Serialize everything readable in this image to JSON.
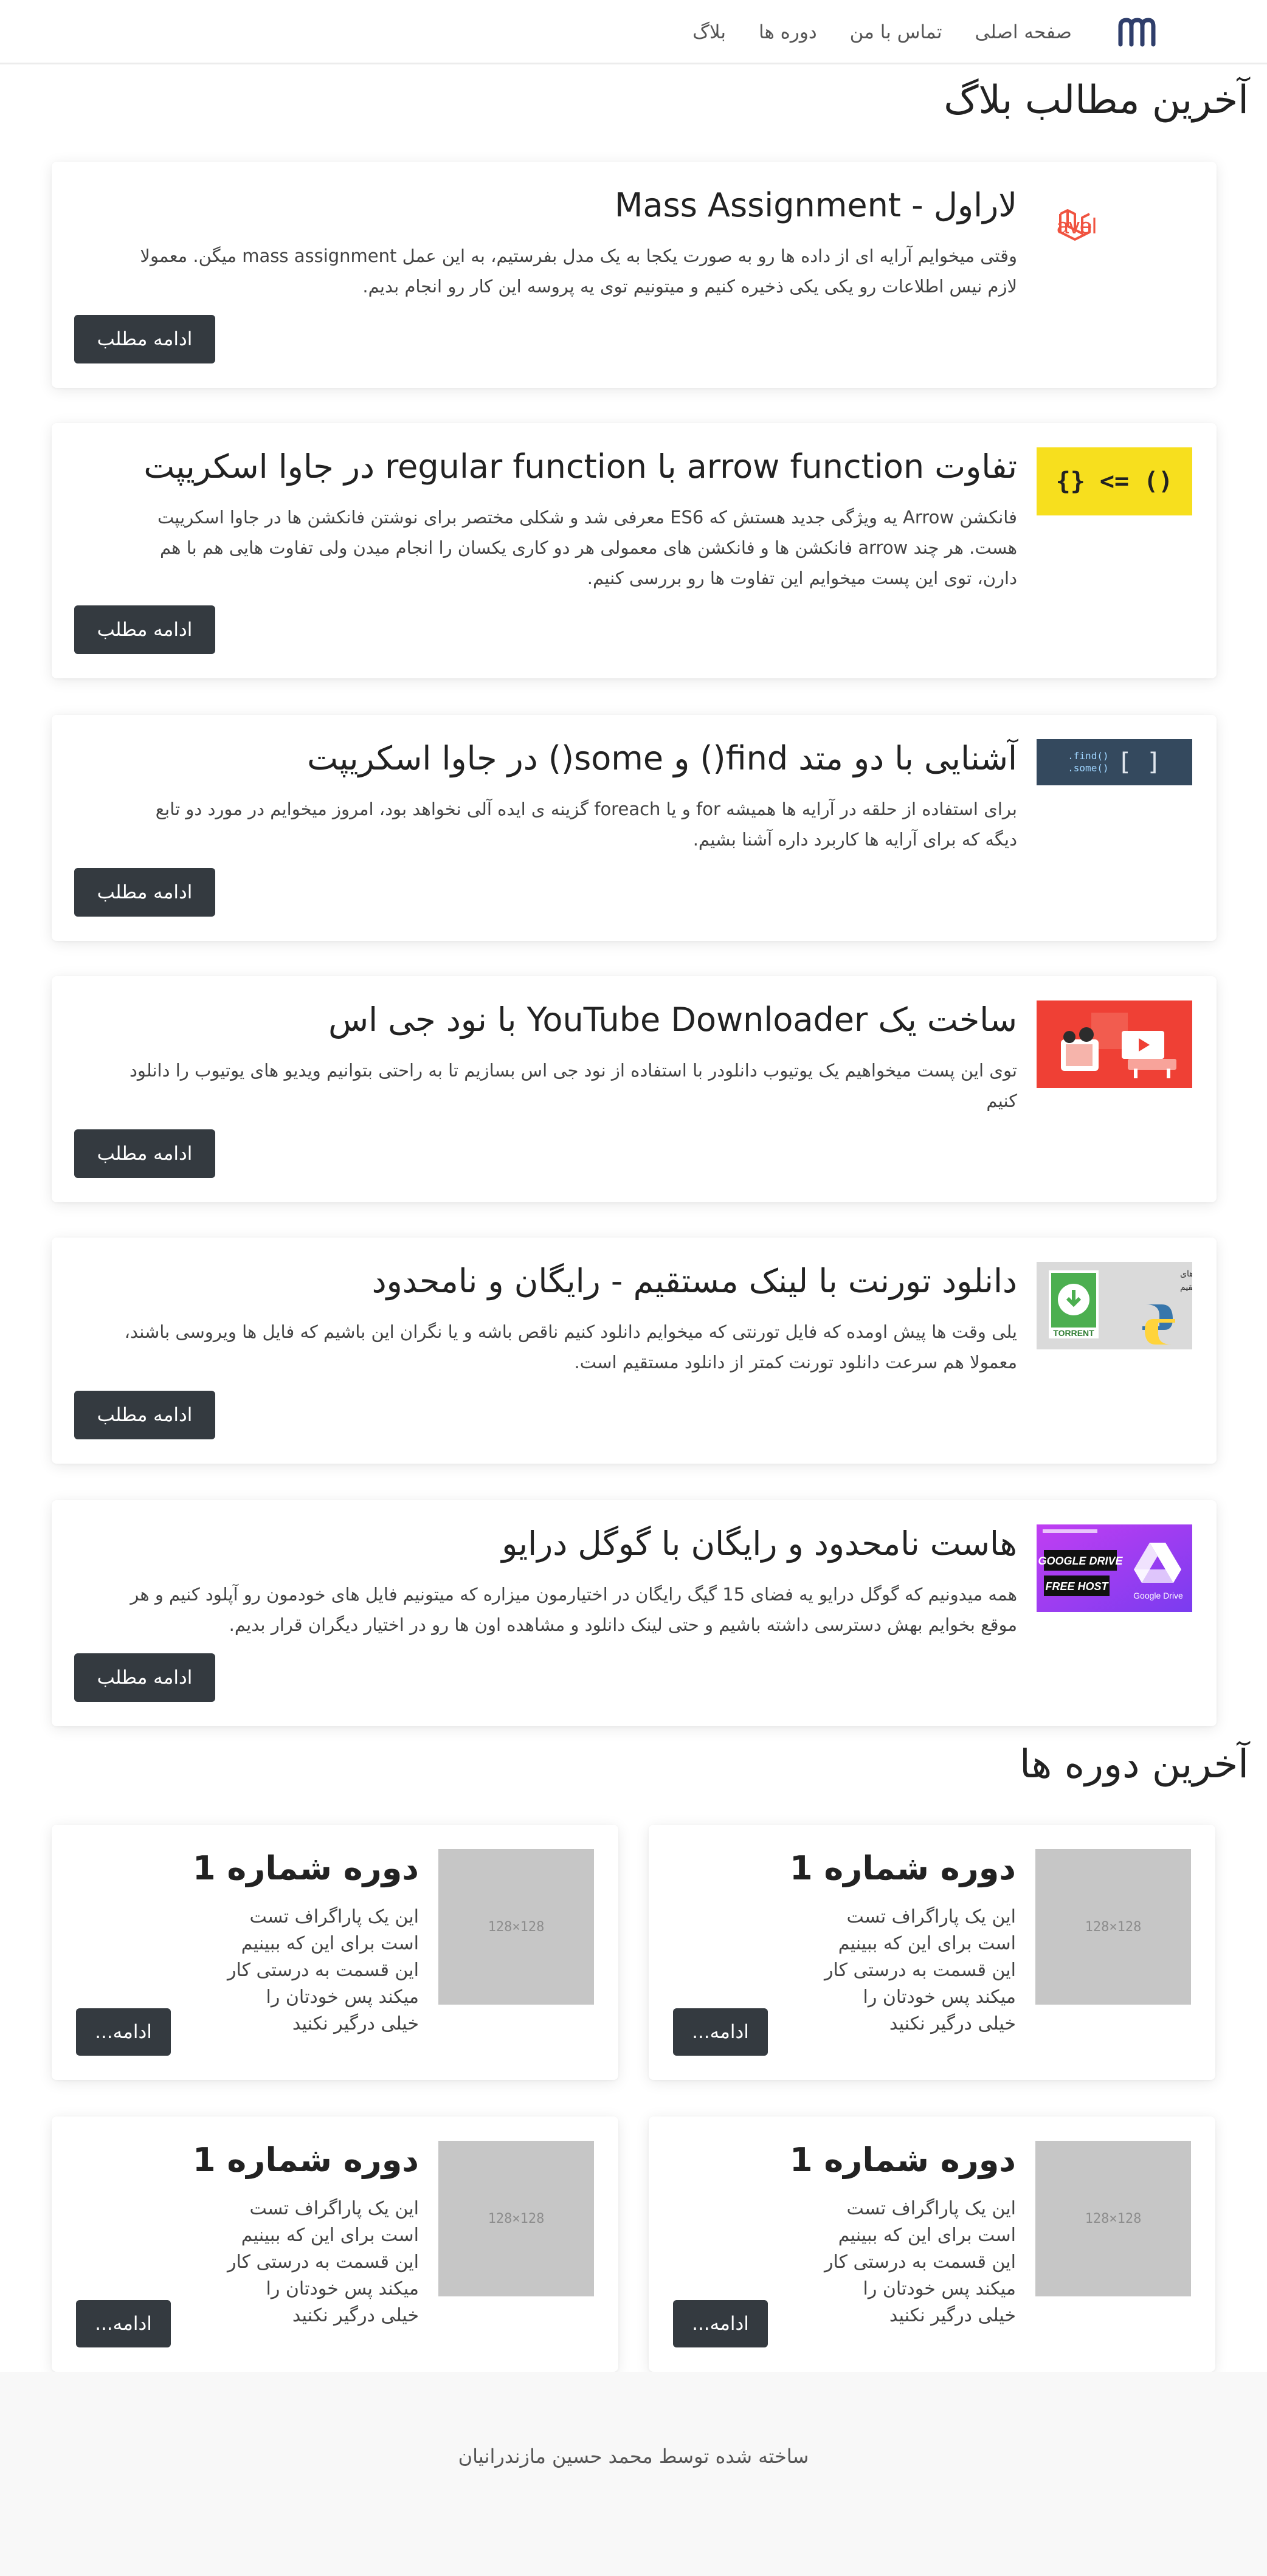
{
  "nav": {
    "links": [
      "صفحه اصلی",
      "تماس با من",
      "دوره ها",
      "بلاگ"
    ]
  },
  "blog_section_title": "آخرین مطالب بلاگ",
  "posts": [
    {
      "title": "لاراول - Mass Assignment",
      "excerpt": "وقتی میخوایم آرایه ای از داده ها رو به صورت یکجا به یک مدل بفرستیم، به این عمل mass assignment میگن. معمولا لازم نیس اطلاعات رو یکی یکی ذخیره کنیم و میتونیم توی یه پروسه این کار رو انجام بدیم.",
      "button": "ادامه مطلب",
      "thumb_text": "Laravel"
    },
    {
      "title": "تفاوت arrow function با regular function در جاوا اسکریپت",
      "excerpt": "فانکشن Arrow یه ویژگی جدید هستش که ES6 معرفی شد و شکلی مختصر برای نوشتن فانکشن ها در جاوا اسکریپت هست. هر چند arrow فانکشن ها و فانکشن های معمولی هر دو کاری یکسان را انجام میدن ولی تفاوت هایی هم با هم دارن، توی این پست میخوایم این تفاوت ها رو بررسی کنیم.",
      "button": "ادامه مطلب",
      "thumb_text": "() => {}"
    },
    {
      "title": "آشنایی با دو متد find() و some() در جاوا اسکریپت",
      "excerpt": "برای استفاده از حلقه در آرایه ها همیشه for و یا foreach گزینه ی ایده آلی نخواهد بود، امروز میخوایم در مورد دو تابع دیگه که برای آرایه ها کاربرد داره آشنا بشیم.",
      "button": "ادامه مطلب",
      "thumb_text_a": "[ ]",
      "thumb_text_b": ".find()",
      "thumb_text_c": ".some()"
    },
    {
      "title": "ساخت یک YouTube Downloader با نود جی اس",
      "excerpt": "توی این پست میخواهیم یک یوتیوب دانلودر با استفاده از نود جی اس بسازیم تا به راحتی بتوانیم ویدیو های یوتیوب را دانلود کنیم",
      "button": "ادامه مطلب"
    },
    {
      "title": "دانلود تورنت با لینک مستقیم - رایگان و نامحدود",
      "excerpt": "یلی وقت ها پیش اومده که فایل تورنتی که میخوایم دانلود کنیم ناقص باشه و یا نگران این باشیم که فایل ها ویروسی باشند، معمولا هم سرعت دانلود تورنت کمتر از دانلود مستقیم است.",
      "button": "ادامه مطلب",
      "thumb_text_a": "راکنور فایل های",
      "thumb_text_b": "تورنت با لینک مستقیم",
      "thumb_text_c": "TORRENT"
    },
    {
      "title": "هاست نامحدود و رایگان با گوگل درایو",
      "excerpt": "همه میدونیم که گوگل درایو یه فضای 15 گیگ رایگان در اختیارمون میزاره که میتونیم فایل های خودمون رو آپلود کنیم و هر موقع بخوایم بهش دسترسی داشته باشیم و حتی لینک دانلود و مشاهده اون ها رو در اختیار دیگران قرار بدیم.",
      "button": "ادامه مطلب",
      "thumb_text_a": "GOOGLE DRIVE",
      "thumb_text_b": "FREE HOST",
      "thumb_text_c": "Google Drive"
    }
  ],
  "courses_section_title": "آخرین دوره ها",
  "courses": [
    {
      "title": "دوره شماره 1",
      "text": "این یک پاراگراف تست است برای این که ببینیم این قسمت به درستی کار میکند پس خودتان را خیلی درگیر نکنید",
      "button": "ادامه...",
      "thumb_label": "128×128"
    },
    {
      "title": "دوره شماره 1",
      "text": "این یک پاراگراف تست است برای این که ببینیم این قسمت به درستی کار میکند پس خودتان را خیلی درگیر نکنید",
      "button": "ادامه...",
      "thumb_label": "128×128"
    },
    {
      "title": "دوره شماره 1",
      "text": "این یک پاراگراف تست است برای این که ببینیم این قسمت به درستی کار میکند پس خودتان را خیلی درگیر نکنید",
      "button": "ادامه...",
      "thumb_label": "128×128"
    },
    {
      "title": "دوره شماره 1",
      "text": "این یک پاراگراف تست است برای این که ببینیم این قسمت به درستی کار میکند پس خودتان را خیلی درگیر نکنید",
      "button": "ادامه...",
      "thumb_label": "128×128"
    }
  ],
  "footer": {
    "text": "ساخته شده توسط محمد حسین مازندرانیان"
  },
  "colors": {
    "button_bg": "#343a40",
    "laravel_red": "#f05340",
    "js_yellow": "#f7df1e",
    "youtube_red": "#ef4035"
  }
}
